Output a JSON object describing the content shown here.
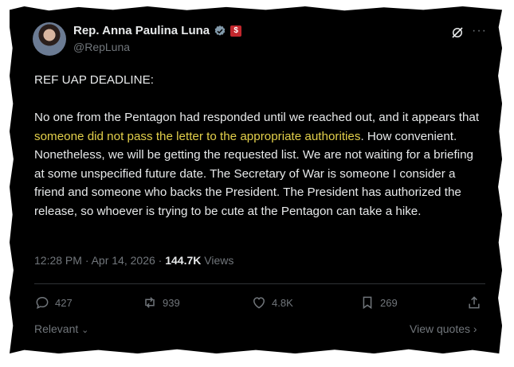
{
  "author": {
    "name": "Rep. Anna Paulina Luna",
    "handle": "@RepLuna"
  },
  "post": {
    "headline": "REF UAP DEADLINE:",
    "text_before": "No one from the Pentagon had responded until we reached out, and it appears that ",
    "highlight": "someone did not pass the letter to the appropriate authorities",
    "text_after": ". How convenient. Nonetheless, we will be getting the requested list. We are not waiting for a briefing at some unspecified future date. The Secretary of War is someone I consider a friend and someone who backs the President. The President has authorized the release, so whoever is trying to be cute at the Pentagon can take a hike.",
    "timestamp": "12:28 PM · Apr 14, 2026 · ",
    "views_count": "144.7K",
    "views_label": " Views"
  },
  "actions": {
    "replies": "427",
    "reposts": "939",
    "likes": "4.8K",
    "bookmarks": "269"
  },
  "footer": {
    "sort_label": "Relevant",
    "quotes_label": "View quotes"
  },
  "colors": {
    "background": "#000000",
    "text": "#e7e9ea",
    "muted": "#71767b",
    "highlight": "#e2cf4a",
    "verified": "#829aab",
    "flag": "#c2272d"
  }
}
